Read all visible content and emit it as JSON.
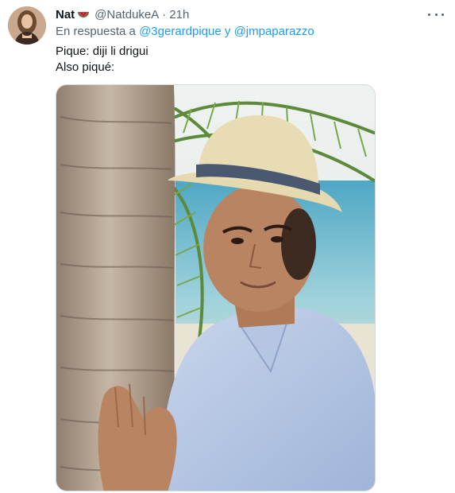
{
  "tweet": {
    "author": {
      "display_name": "Nat",
      "name_emoji": "watermelon-slice",
      "handle": "@NatdukeA",
      "separator": "·",
      "time": "21h"
    },
    "reply": {
      "prefix": "En respuesta a",
      "mention_1": "@3gerardpique",
      "conjunction": "y",
      "mention_2": "@jmpaparazzo"
    },
    "text_lines": [
      "Pique: diji li drigui",
      "Also piqué:"
    ],
    "media": {
      "subject": "man in straw hat leaning on palm tree"
    },
    "more_icon": "ellipsis-icon"
  },
  "colors": {
    "text": "#0f1419",
    "secondary": "#536471",
    "link": "#1d9bf0"
  }
}
